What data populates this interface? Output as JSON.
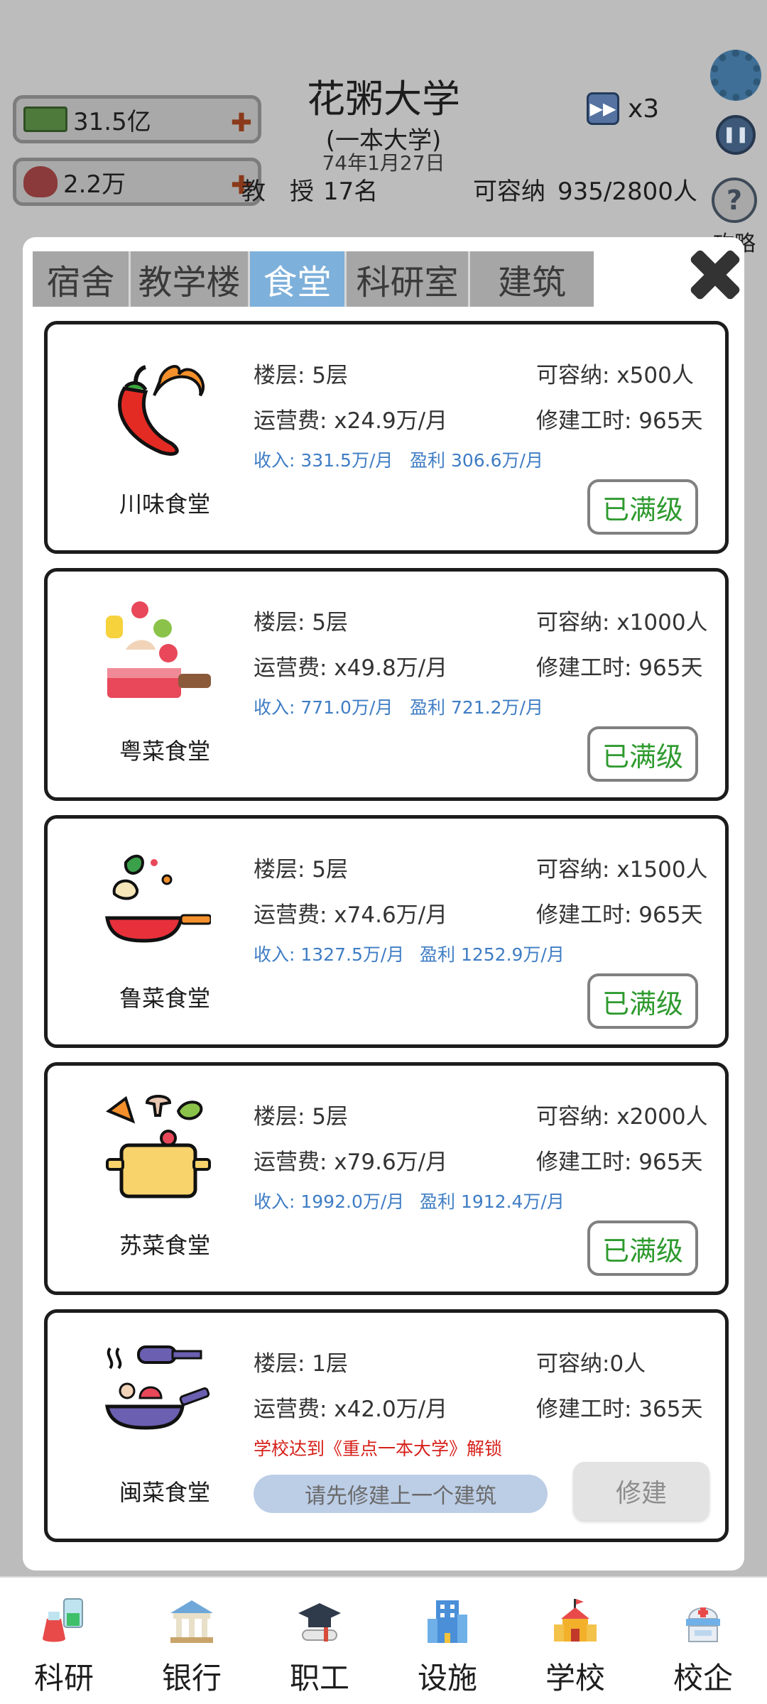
{
  "header": {
    "money": "31.5亿",
    "reputation": "2.2万",
    "school_name": "花粥大学",
    "school_rank": "(一本大学)",
    "date": "74年1月27日",
    "professors_label": "教　授",
    "professors_value": "17名",
    "capacity_label": "可容纳",
    "capacity_value": "935/2800人",
    "speed": "x3",
    "help_label": "攻略"
  },
  "modal": {
    "tabs": [
      "宿舍",
      "教学楼",
      "食堂",
      "科研室",
      "建筑"
    ],
    "active_tab": 2,
    "cards": [
      {
        "name": "川味食堂",
        "floors": "楼层: 5层",
        "capacity": "可容纳: x500人",
        "op_cost": "运营费: x24.9万/月",
        "build_time": "修建工时: 965天",
        "income": "收入: 331.5万/月",
        "profit": "盈利 306.6万/月",
        "button": "已满级"
      },
      {
        "name": "粤菜食堂",
        "floors": "楼层: 5层",
        "capacity": "可容纳: x1000人",
        "op_cost": "运营费: x49.8万/月",
        "build_time": "修建工时: 965天",
        "income": "收入: 771.0万/月",
        "profit": "盈利 721.2万/月",
        "button": "已满级"
      },
      {
        "name": "鲁菜食堂",
        "floors": "楼层: 5层",
        "capacity": "可容纳: x1500人",
        "op_cost": "运营费: x74.6万/月",
        "build_time": "修建工时: 965天",
        "income": "收入: 1327.5万/月",
        "profit": "盈利 1252.9万/月",
        "button": "已满级"
      },
      {
        "name": "苏菜食堂",
        "floors": "楼层: 5层",
        "capacity": "可容纳: x2000人",
        "op_cost": "运营费: x79.6万/月",
        "build_time": "修建工时: 965天",
        "income": "收入: 1992.0万/月",
        "profit": "盈利 1912.4万/月",
        "button": "已满级"
      },
      {
        "name": "闽菜食堂",
        "floors": "楼层: 1层",
        "capacity": "可容纳:0人",
        "op_cost": "运营费: x42.0万/月",
        "build_time": "修建工时: 365天",
        "unlock_note": "学校达到《重点一本大学》解锁",
        "prereq": "请先修建上一个建筑",
        "button": "修建"
      }
    ]
  },
  "bottom_nav": [
    {
      "label": "科研",
      "icon": "flask-icon"
    },
    {
      "label": "银行",
      "icon": "bank-icon"
    },
    {
      "label": "职工",
      "icon": "graduation-cap-icon"
    },
    {
      "label": "设施",
      "icon": "building-icon"
    },
    {
      "label": "学校",
      "icon": "school-icon"
    },
    {
      "label": "校企",
      "icon": "hospital-icon"
    }
  ]
}
